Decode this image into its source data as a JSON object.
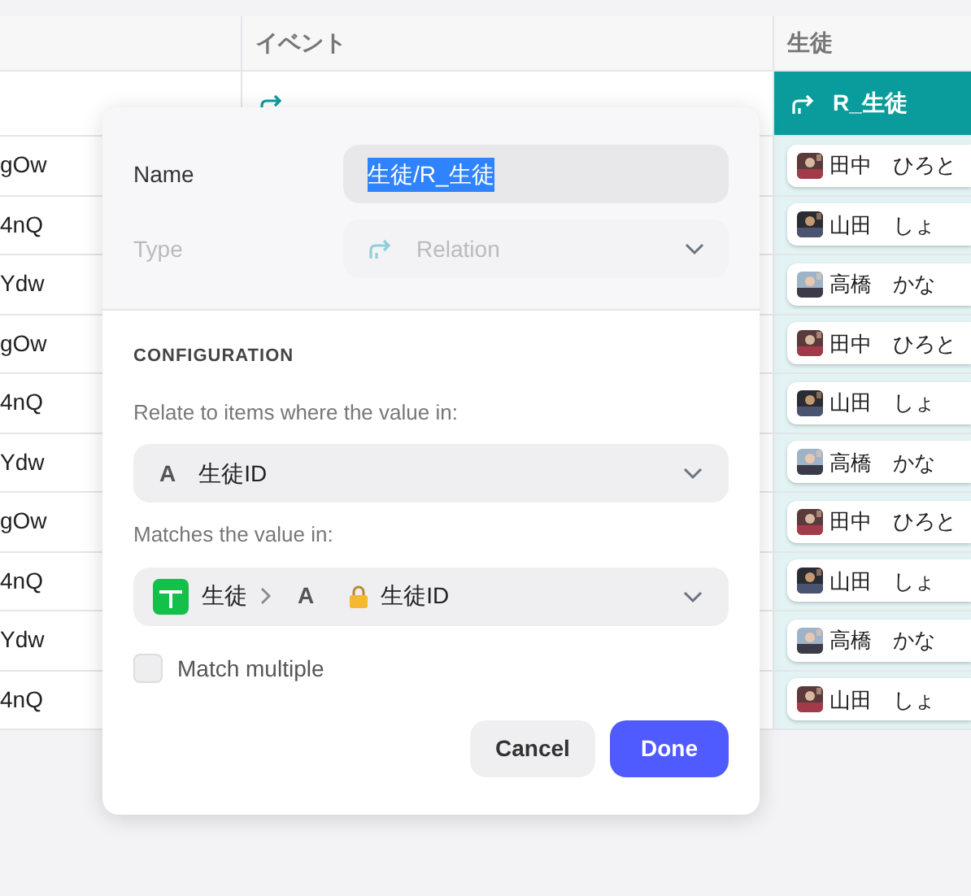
{
  "table": {
    "column_headers": [
      {
        "label": "イベント"
      },
      {
        "label": "生徒"
      }
    ],
    "field_headers": [
      {
        "selected": false
      },
      {
        "label": "R_生徒",
        "selected": true
      }
    ],
    "rows": [
      {
        "column_1": "gOw",
        "student": "田中　ひろと"
      },
      {
        "column_1": "4nQ",
        "student": "山田　しょ"
      },
      {
        "column_1": "Ydw",
        "student": "高橋　かな"
      },
      {
        "column_1": "gOw",
        "student": "田中　ひろと"
      },
      {
        "column_1": "4nQ",
        "student": "山田　しょ"
      },
      {
        "column_1": "Ydw",
        "student": "高橋　かな"
      },
      {
        "column_1": "gOw",
        "student": "田中　ひろと"
      },
      {
        "column_1": "4nQ",
        "student": "山田　しょ"
      },
      {
        "column_1": "Ydw",
        "student": "高橋　かな"
      },
      {
        "column_1": "4nQ",
        "student": "山田　しょ"
      }
    ]
  },
  "dialog": {
    "name_label": "Name",
    "name_value": "生徒/R_生徒",
    "name_selected": true,
    "type_label": "Type",
    "type_value": "Relation",
    "type_disabled": true,
    "section_title": "CONFIGURATION",
    "relate_label": "Relate to items where the value in:",
    "relate_field": {
      "type_glyph": "A",
      "value": "生徒ID"
    },
    "match_label": "Matches the value in:",
    "match_field": {
      "table": "生徒",
      "type_glyph": "A",
      "value": "生徒ID",
      "locked": true
    },
    "match_multiple": {
      "label": "Match multiple",
      "checked": false
    },
    "buttons": [
      {
        "label": "Cancel",
        "kind": "secondary"
      },
      {
        "label": "Done",
        "kind": "primary"
      }
    ]
  }
}
